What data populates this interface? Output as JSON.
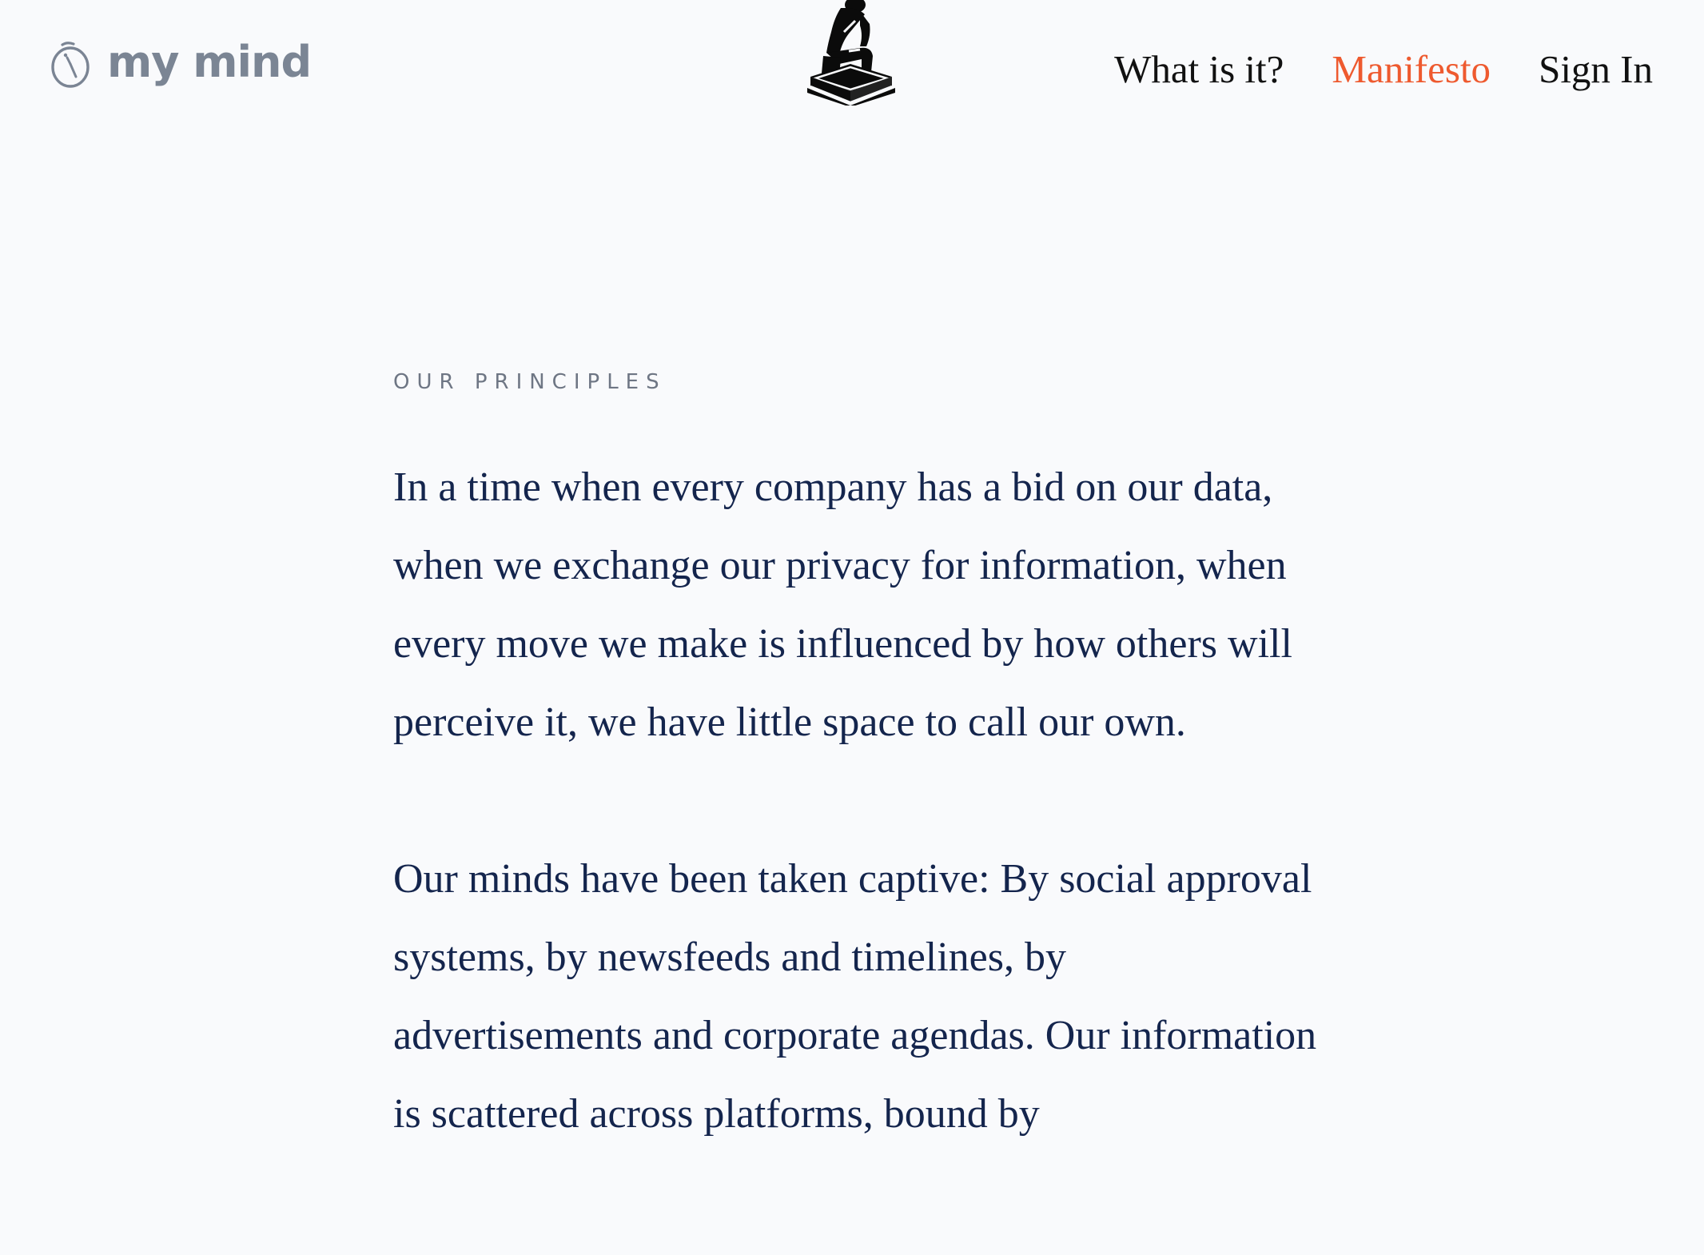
{
  "header": {
    "logo_text": "my mind",
    "nav": [
      {
        "label": "What is it?",
        "active": false
      },
      {
        "label": "Manifesto",
        "active": true
      },
      {
        "label": "Sign In",
        "active": false
      }
    ]
  },
  "main": {
    "kicker": "OUR PRINCIPLES",
    "paragraphs": [
      "In a time when every company has a bid on our data, when we exchange our privacy for information, when every move we make is influenced by how others will perceive it, we have little space to call our own.",
      "Our minds have been taken captive: By social approval systems, by newsfeeds and timelines, by advertisements and corporate agendas. Our information is scattered across platforms, bound by"
    ]
  },
  "colors": {
    "background": "#f9fafc",
    "body_text": "#14254d",
    "accent": "#ee5a2f",
    "logo": "#7b8594",
    "kicker": "#6e7684"
  },
  "icons": {
    "logo": "clock-circle-icon",
    "center": "thinker-statue-icon"
  }
}
